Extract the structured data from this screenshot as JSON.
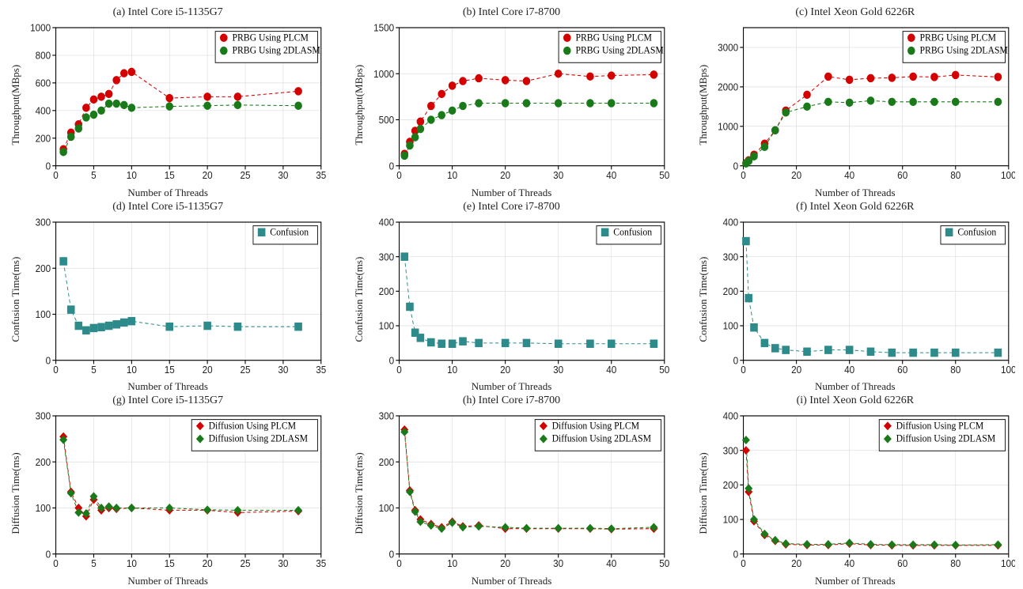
{
  "xlabel": "Number of Threads",
  "legend_labels": {
    "plcm_prbg": "PRBG Using PLCM",
    "2dlasm_prbg": "PRBG Using 2DLASM",
    "confusion": "Confusion",
    "plcm_diff": "Diffusion Using PLCM",
    "2dlasm_diff": "Diffusion Using 2DLASM"
  },
  "chart_data": [
    {
      "id": "a",
      "title": "(a) Intel Core i5-1135G7",
      "ylabel": "Throughput(MBps)",
      "type": "line",
      "xlim": [
        0,
        35
      ],
      "ylim": [
        0,
        1000
      ],
      "xticks": [
        0,
        5,
        10,
        15,
        20,
        25,
        30,
        35
      ],
      "yticks": [
        0,
        200,
        400,
        600,
        800,
        1000
      ],
      "series": [
        {
          "name": "plcm_prbg",
          "color": "#d40000",
          "marker": "circle",
          "x": [
            1,
            2,
            3,
            4,
            5,
            6,
            7,
            8,
            9,
            10,
            15,
            20,
            24,
            32
          ],
          "y": [
            120,
            240,
            300,
            420,
            480,
            500,
            520,
            620,
            670,
            680,
            490,
            500,
            500,
            540
          ]
        },
        {
          "name": "2dlasm_prbg",
          "color": "#1a7a1a",
          "marker": "circle",
          "x": [
            1,
            2,
            3,
            4,
            5,
            6,
            7,
            8,
            9,
            10,
            15,
            20,
            24,
            32
          ],
          "y": [
            100,
            210,
            270,
            350,
            370,
            400,
            450,
            450,
            440,
            420,
            430,
            435,
            440,
            435
          ]
        }
      ]
    },
    {
      "id": "b",
      "title": "(b) Intel Core i7-8700",
      "ylabel": "Throughput(MBps)",
      "type": "line",
      "xlim": [
        0,
        50
      ],
      "ylim": [
        0,
        1500
      ],
      "xticks": [
        0,
        10,
        20,
        30,
        40,
        50
      ],
      "yticks": [
        0,
        500,
        1000,
        1500
      ],
      "series": [
        {
          "name": "plcm_prbg",
          "color": "#d40000",
          "marker": "circle",
          "x": [
            1,
            2,
            3,
            4,
            6,
            8,
            10,
            12,
            15,
            20,
            24,
            30,
            36,
            40,
            48
          ],
          "y": [
            130,
            260,
            380,
            480,
            650,
            780,
            870,
            920,
            950,
            930,
            920,
            1000,
            970,
            980,
            990
          ]
        },
        {
          "name": "2dlasm_prbg",
          "color": "#1a7a1a",
          "marker": "circle",
          "x": [
            1,
            2,
            3,
            4,
            6,
            8,
            10,
            12,
            15,
            20,
            24,
            30,
            36,
            40,
            48
          ],
          "y": [
            110,
            220,
            310,
            400,
            500,
            550,
            600,
            650,
            680,
            680,
            680,
            680,
            680,
            680,
            680
          ]
        }
      ]
    },
    {
      "id": "c",
      "title": "(c) Intel Xeon Gold 6226R",
      "ylabel": "Throughput(MBps)",
      "type": "line",
      "xlim": [
        0,
        100
      ],
      "ylim": [
        0,
        3500
      ],
      "xticks": [
        0,
        20,
        40,
        60,
        80,
        100
      ],
      "yticks": [
        0,
        1000,
        2000,
        3000
      ],
      "series": [
        {
          "name": "plcm_prbg",
          "color": "#d40000",
          "marker": "circle",
          "x": [
            1,
            2,
            4,
            8,
            12,
            16,
            24,
            32,
            40,
            48,
            56,
            64,
            72,
            80,
            96
          ],
          "y": [
            70,
            140,
            280,
            560,
            900,
            1400,
            1800,
            2260,
            2180,
            2220,
            2230,
            2260,
            2250,
            2300,
            2250
          ]
        },
        {
          "name": "2dlasm_prbg",
          "color": "#1a7a1a",
          "marker": "circle",
          "x": [
            1,
            2,
            4,
            8,
            12,
            16,
            24,
            32,
            40,
            48,
            56,
            64,
            72,
            80,
            96
          ],
          "y": [
            60,
            120,
            240,
            480,
            900,
            1350,
            1500,
            1620,
            1600,
            1650,
            1620,
            1620,
            1620,
            1620,
            1620
          ]
        }
      ]
    },
    {
      "id": "d",
      "title": "(d) Intel Core i5-1135G7",
      "ylabel": "Confusion Time(ms)",
      "type": "line",
      "xlim": [
        0,
        35
      ],
      "ylim": [
        0,
        300
      ],
      "xticks": [
        0,
        5,
        10,
        15,
        20,
        25,
        30,
        35
      ],
      "yticks": [
        0,
        100,
        200,
        300
      ],
      "series": [
        {
          "name": "confusion",
          "color": "#2e8b8b",
          "marker": "square",
          "x": [
            1,
            2,
            3,
            4,
            5,
            6,
            7,
            8,
            9,
            10,
            15,
            20,
            24,
            32
          ],
          "y": [
            215,
            110,
            75,
            65,
            70,
            72,
            75,
            78,
            82,
            85,
            73,
            75,
            73,
            73
          ]
        }
      ]
    },
    {
      "id": "e",
      "title": "(e) Intel Core i7-8700",
      "ylabel": "Confusion Time(ms)",
      "type": "line",
      "xlim": [
        0,
        50
      ],
      "ylim": [
        0,
        400
      ],
      "xticks": [
        0,
        10,
        20,
        30,
        40,
        50
      ],
      "yticks": [
        0,
        100,
        200,
        300,
        400
      ],
      "series": [
        {
          "name": "confusion",
          "color": "#2e8b8b",
          "marker": "square",
          "x": [
            1,
            2,
            3,
            4,
            6,
            8,
            10,
            12,
            15,
            20,
            24,
            30,
            36,
            40,
            48
          ],
          "y": [
            300,
            155,
            80,
            65,
            52,
            48,
            48,
            55,
            50,
            50,
            50,
            48,
            48,
            48,
            48
          ]
        }
      ]
    },
    {
      "id": "f",
      "title": "(f) Intel Xeon Gold 6226R",
      "ylabel": "Confusion Time(ms)",
      "type": "line",
      "xlim": [
        0,
        100
      ],
      "ylim": [
        0,
        400
      ],
      "xticks": [
        0,
        20,
        40,
        60,
        80,
        100
      ],
      "yticks": [
        0,
        100,
        200,
        300,
        400
      ],
      "series": [
        {
          "name": "confusion",
          "color": "#2e8b8b",
          "marker": "square",
          "x": [
            1,
            2,
            4,
            8,
            12,
            16,
            24,
            32,
            40,
            48,
            56,
            64,
            72,
            80,
            96
          ],
          "y": [
            345,
            180,
            95,
            50,
            35,
            30,
            25,
            30,
            30,
            25,
            22,
            22,
            22,
            22,
            22
          ]
        }
      ]
    },
    {
      "id": "g",
      "title": "(g) Intel Core i5-1135G7",
      "ylabel": "Diffusion Time(ms)",
      "type": "line",
      "xlim": [
        0,
        35
      ],
      "ylim": [
        0,
        300
      ],
      "xticks": [
        0,
        5,
        10,
        15,
        20,
        25,
        30,
        35
      ],
      "yticks": [
        0,
        100,
        200,
        300
      ],
      "series": [
        {
          "name": "plcm_diff",
          "color": "#d40000",
          "marker": "diamond",
          "x": [
            1,
            2,
            3,
            4,
            5,
            6,
            7,
            8,
            10,
            15,
            20,
            24,
            32
          ],
          "y": [
            255,
            135,
            100,
            82,
            118,
            95,
            100,
            98,
            100,
            95,
            95,
            90,
            93
          ]
        },
        {
          "name": "2dlasm_diff",
          "color": "#1a7a1a",
          "marker": "diamond",
          "x": [
            1,
            2,
            3,
            4,
            5,
            6,
            7,
            8,
            10,
            15,
            20,
            24,
            32
          ],
          "y": [
            248,
            132,
            90,
            88,
            125,
            100,
            103,
            100,
            100,
            100,
            96,
            95,
            95
          ]
        }
      ]
    },
    {
      "id": "h",
      "title": "(h) Intel Core i7-8700",
      "ylabel": "Diffusion Time(ms)",
      "type": "line",
      "xlim": [
        0,
        50
      ],
      "ylim": [
        0,
        300
      ],
      "xticks": [
        0,
        10,
        20,
        30,
        40,
        50
      ],
      "yticks": [
        0,
        100,
        200,
        300
      ],
      "series": [
        {
          "name": "plcm_diff",
          "color": "#d40000",
          "marker": "diamond",
          "x": [
            1,
            2,
            3,
            4,
            6,
            8,
            10,
            12,
            15,
            20,
            24,
            30,
            36,
            40,
            48
          ],
          "y": [
            270,
            138,
            95,
            75,
            65,
            58,
            70,
            60,
            62,
            55,
            55,
            55,
            55,
            54,
            55
          ]
        },
        {
          "name": "2dlasm_diff",
          "color": "#1a7a1a",
          "marker": "diamond",
          "x": [
            1,
            2,
            3,
            4,
            6,
            8,
            10,
            12,
            15,
            20,
            24,
            30,
            36,
            40,
            48
          ],
          "y": [
            265,
            135,
            92,
            70,
            62,
            55,
            68,
            58,
            60,
            58,
            56,
            56,
            56,
            55,
            58
          ]
        }
      ]
    },
    {
      "id": "i",
      "title": "(i) Intel Xeon Gold 6226R",
      "ylabel": "Diffusion Time(ms)",
      "type": "line",
      "xlim": [
        0,
        100
      ],
      "ylim": [
        0,
        400
      ],
      "xticks": [
        0,
        20,
        40,
        60,
        80,
        100
      ],
      "yticks": [
        0,
        100,
        200,
        300,
        400
      ],
      "series": [
        {
          "name": "plcm_diff",
          "color": "#d40000",
          "marker": "diamond",
          "x": [
            1,
            2,
            4,
            8,
            12,
            16,
            24,
            32,
            40,
            48,
            56,
            64,
            72,
            80,
            96
          ],
          "y": [
            300,
            180,
            95,
            55,
            38,
            28,
            26,
            26,
            30,
            26,
            25,
            25,
            25,
            25,
            25
          ]
        },
        {
          "name": "2dlasm_diff",
          "color": "#1a7a1a",
          "marker": "diamond",
          "x": [
            1,
            2,
            4,
            8,
            12,
            16,
            24,
            32,
            40,
            48,
            56,
            64,
            72,
            80,
            96
          ],
          "y": [
            330,
            190,
            100,
            58,
            40,
            30,
            28,
            28,
            32,
            28,
            27,
            27,
            27,
            26,
            27
          ]
        }
      ]
    }
  ]
}
